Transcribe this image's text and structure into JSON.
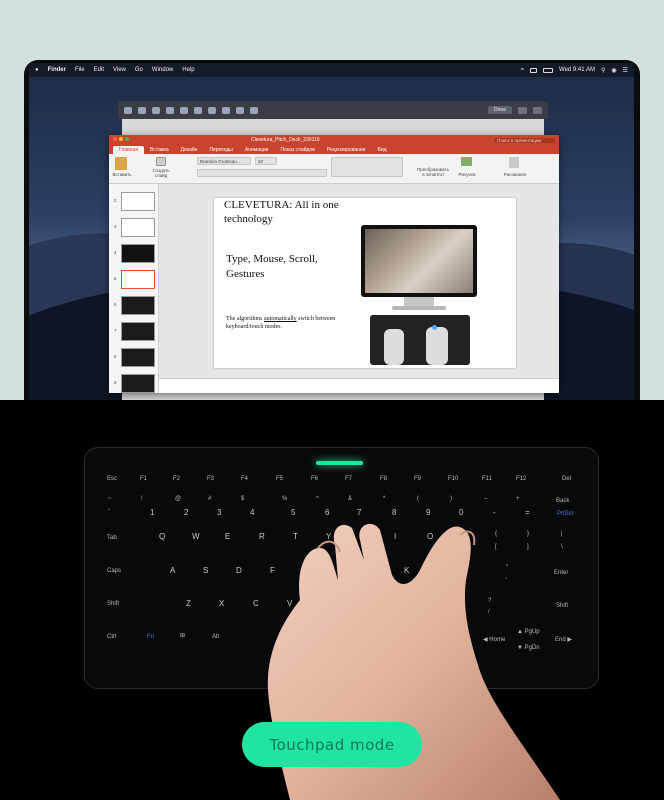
{
  "menubar": {
    "apple": "",
    "items": [
      "Finder",
      "File",
      "Edit",
      "View",
      "Go",
      "Window",
      "Help"
    ],
    "clock": "Wed 9:41 AM"
  },
  "markup_toolbar": {
    "done_label": "Done"
  },
  "powerpoint": {
    "doc_title": "Clevetura_Pitch_Deck_230119",
    "search_placeholder": "Поиск в презентации",
    "tabs": [
      "Главная",
      "Вставка",
      "Дизайн",
      "Переходы",
      "Анимации",
      "Показ слайдов",
      "Рецензирование",
      "Вид"
    ],
    "active_tab": 0,
    "ribbon": {
      "paste": "Вставить",
      "new_slide_1": "Создать",
      "new_slide_2": "слайд",
      "font_name": "Brandon Grotesqu...",
      "font_size": "32",
      "convert_1": "Преобразовать",
      "convert_2": "в SmartArt",
      "picture": "Рисунок",
      "drawing": "Рисование"
    },
    "slide_numbers": [
      "2",
      "3",
      "4",
      "5",
      "6",
      "7",
      "8",
      "9"
    ],
    "slide": {
      "title": "CLEVETURA: All in one technology",
      "subtitle": "Type, Mouse, Scroll, Gestures",
      "body_pre": "The algorithms ",
      "body_u": "automatically",
      "body_post": " switch between keyboard/touch modes."
    }
  },
  "keyboard": {
    "fn_row": [
      "Esc",
      "F1",
      "F2",
      "F3",
      "F4",
      "F5",
      "F6",
      "F7",
      "F8",
      "F9",
      "F10",
      "F11",
      "F12",
      "Del"
    ],
    "num_row": [
      {
        "top": "~",
        "bot": "`"
      },
      {
        "top": "!",
        "bot": "1"
      },
      {
        "top": "@",
        "bot": "2"
      },
      {
        "top": "#",
        "bot": "3"
      },
      {
        "top": "$",
        "bot": "4"
      },
      {
        "top": "%",
        "bot": "5"
      },
      {
        "top": "^",
        "bot": "6"
      },
      {
        "top": "&",
        "bot": "7"
      },
      {
        "top": "*",
        "bot": "8"
      },
      {
        "top": "(",
        "bot": "9"
      },
      {
        "top": ")",
        "bot": "0"
      },
      {
        "top": "–",
        "bot": "-"
      },
      {
        "top": "+",
        "bot": "="
      }
    ],
    "back": "Back",
    "prtscr": "PrtScr",
    "tab": "Tab",
    "qwerty": [
      "Q",
      "W",
      "E",
      "R",
      "T",
      "Y",
      "U",
      "I",
      "O",
      "P"
    ],
    "brackets": [
      {
        "top": "{",
        "bot": "["
      },
      {
        "top": "}",
        "bot": "]"
      },
      {
        "top": "|",
        "bot": "\\"
      }
    ],
    "caps": "Caps",
    "asdf": [
      "A",
      "S",
      "D",
      "F",
      "G",
      "H",
      "J",
      "K",
      "L"
    ],
    "quote": {
      "top": "\"",
      "bot": "'"
    },
    "enter": "Enter",
    "shift": "Shift",
    "zxcv": [
      "Z",
      "X",
      "C",
      "V",
      "B",
      "N",
      "M"
    ],
    "slash": {
      "top": "?",
      "bot": "/"
    },
    "shift_r": "Shift",
    "ctrl": "Ctrl",
    "fn": "Fn",
    "alt": "Alt",
    "home": "Home",
    "pgup": "PgUp",
    "pgdn": "PgDn",
    "end": "End"
  },
  "mode_button": {
    "label": "Touchpad mode",
    "color": "#1fe4a4"
  }
}
